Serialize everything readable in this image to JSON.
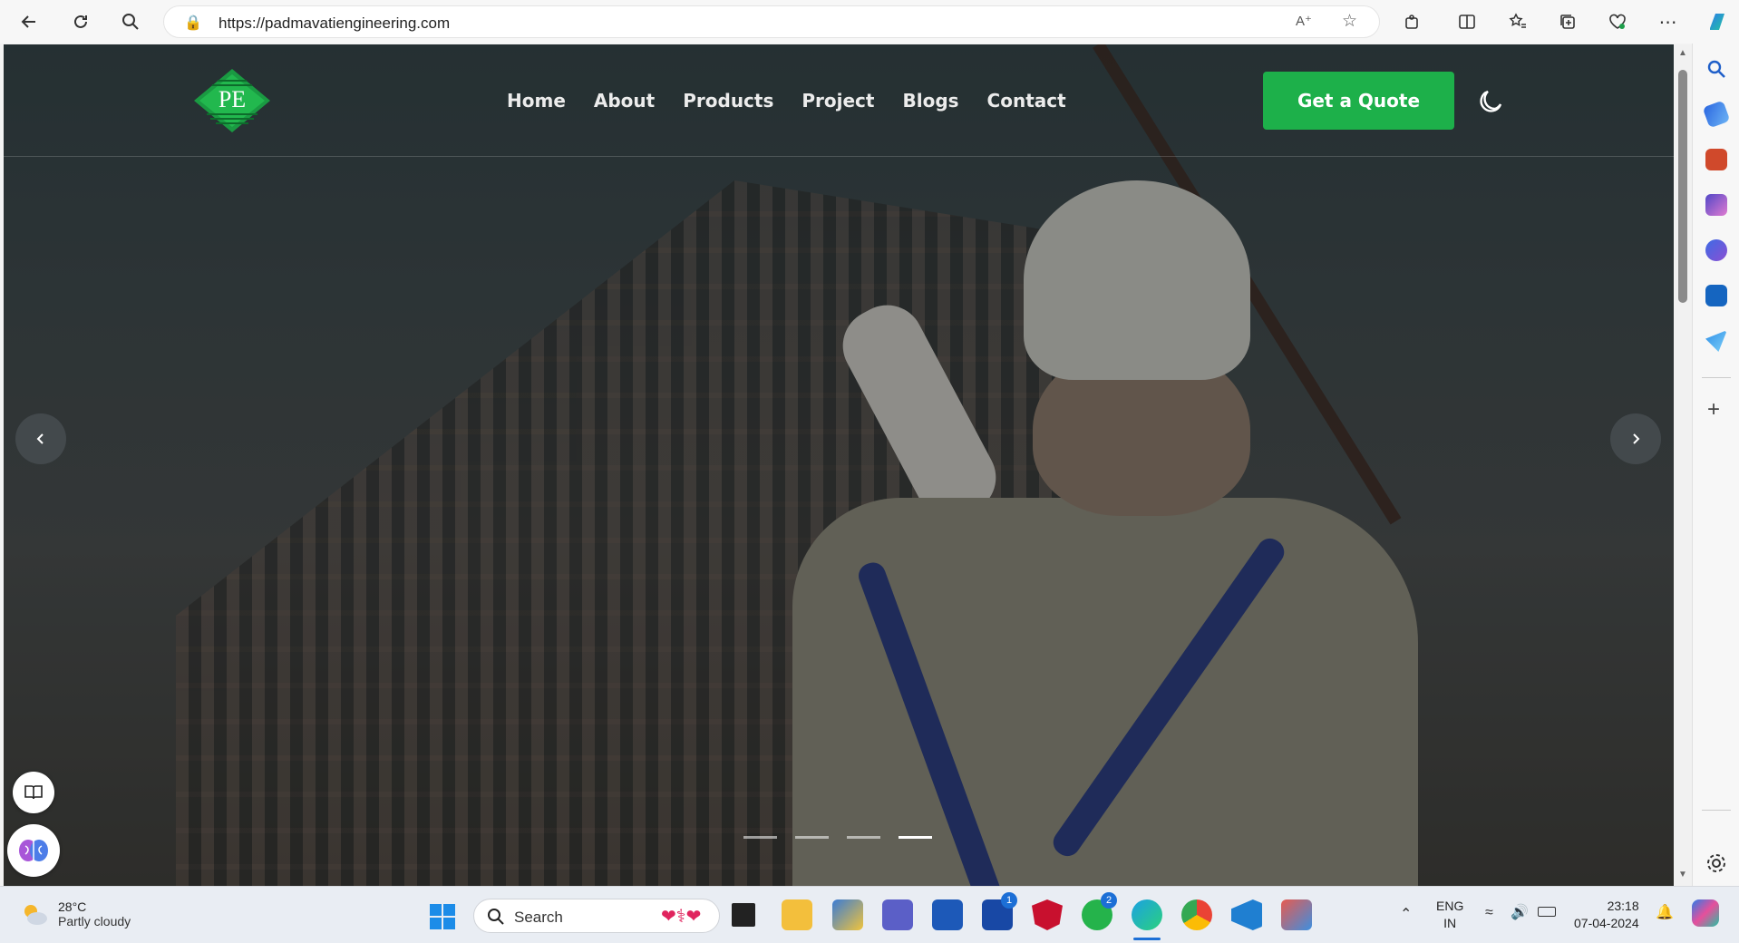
{
  "browser": {
    "url": "https://padmavatiengineering.com"
  },
  "site": {
    "logo_text": "PE",
    "nav": [
      "Home",
      "About",
      "Products",
      "Project",
      "Blogs",
      "Contact"
    ],
    "cta_label": "Get a Quote",
    "slider_dots": 4,
    "active_dot": 4,
    "accent_color": "#1db04a"
  },
  "taskbar": {
    "weather_temp": "28°C",
    "weather_desc": "Partly cloudy",
    "search_label": "Search",
    "lang_line1": "ENG",
    "lang_line2": "IN",
    "time": "23:18",
    "date": "07-04-2024",
    "teams_badge": "1",
    "whatsapp_badge": "2"
  },
  "icons": [
    "back-icon",
    "refresh-icon",
    "search-icon",
    "lock-icon",
    "read-aloud-icon",
    "favorite-star-icon",
    "extensions-icon",
    "split-screen-icon",
    "favorites-icon",
    "collections-icon",
    "browser-essentials-icon",
    "more-icon",
    "copilot-icon",
    "moon-icon",
    "chevron-left-icon",
    "chevron-right-icon",
    "immersive-reader-icon",
    "brain-icon",
    "windows-start-icon",
    "settings-icon",
    "add-icon"
  ]
}
